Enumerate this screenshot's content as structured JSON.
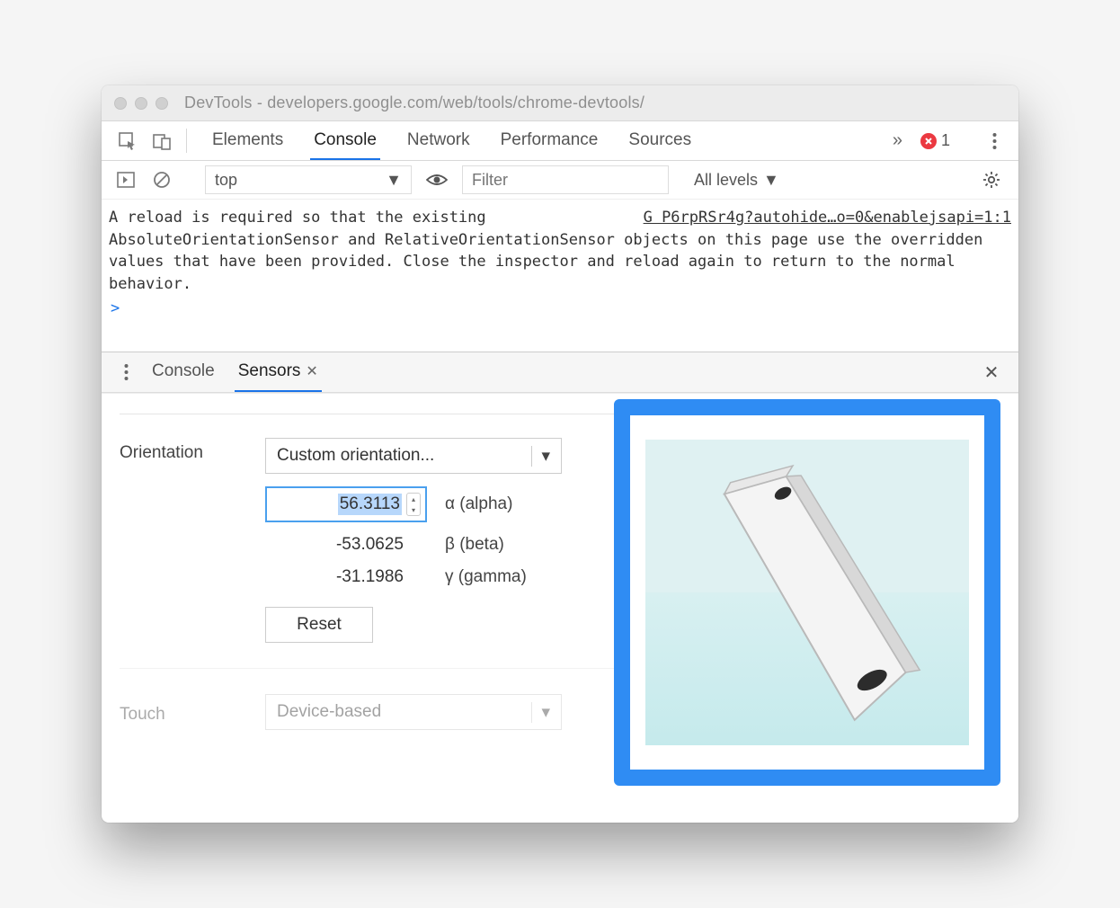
{
  "titlebar": {
    "title": "DevTools - developers.google.com/web/tools/chrome-devtools/"
  },
  "main_tabs": {
    "items": [
      "Elements",
      "Console",
      "Network",
      "Performance",
      "Sources"
    ],
    "active_index": 1,
    "overflow_glyph": "»",
    "error_count": "1"
  },
  "console_toolbar": {
    "context": "top",
    "filter_placeholder": "Filter",
    "levels_label": "All levels"
  },
  "console": {
    "message": "A reload is required so that the existing AbsoluteOrientationSensor and RelativeOrientationSensor objects on this page use the overridden values that have been provided. Close the inspector and reload again to return to the normal behavior.",
    "source_link": "G P6rpRSr4g?autohide…o=0&enablejsapi=1:1",
    "prompt": ">"
  },
  "drawer": {
    "tabs": [
      "Console",
      "Sensors"
    ],
    "active_index": 1
  },
  "sensors": {
    "orientation": {
      "label": "Orientation",
      "preset": "Custom orientation...",
      "alpha": {
        "value": "56.3113",
        "label": "α (alpha)"
      },
      "beta": {
        "value": "-53.0625",
        "label": "β (beta)"
      },
      "gamma": {
        "value": "-31.1986",
        "label": "γ (gamma)"
      },
      "reset_label": "Reset"
    },
    "touch": {
      "label": "Touch",
      "preset": "Device-based"
    }
  }
}
